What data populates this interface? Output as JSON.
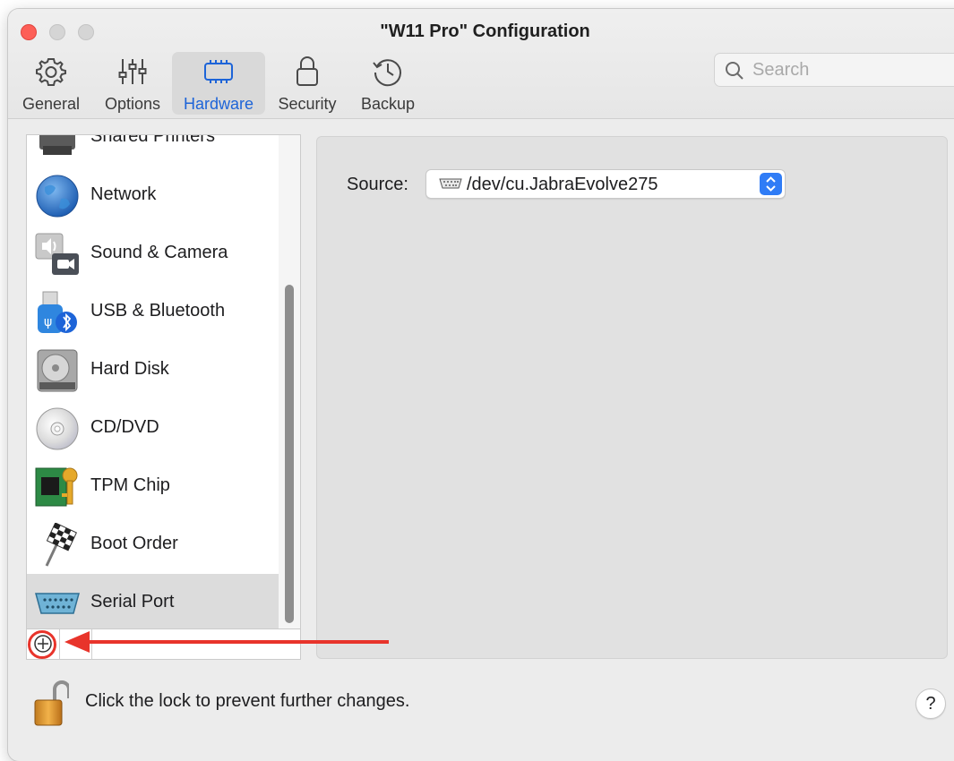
{
  "window": {
    "title": "\"W11 Pro\" Configuration"
  },
  "toolbar": {
    "items": [
      {
        "label": "General",
        "icon": "gear-icon"
      },
      {
        "label": "Options",
        "icon": "sliders-icon"
      },
      {
        "label": "Hardware",
        "icon": "chip-icon",
        "active": true
      },
      {
        "label": "Security",
        "icon": "lock-icon"
      },
      {
        "label": "Backup",
        "icon": "history-clock-icon"
      }
    ],
    "search_placeholder": "Search"
  },
  "sidebar": {
    "items": [
      {
        "label": "Shared Printers",
        "icon": "printer-icon"
      },
      {
        "label": "Network",
        "icon": "globe-icon"
      },
      {
        "label": "Sound & Camera",
        "icon": "speaker-camera-icon"
      },
      {
        "label": "USB & Bluetooth",
        "icon": "usb-bluetooth-icon"
      },
      {
        "label": "Hard Disk",
        "icon": "hard-disk-icon"
      },
      {
        "label": "CD/DVD",
        "icon": "disc-icon"
      },
      {
        "label": "TPM Chip",
        "icon": "tpm-chip-key-icon"
      },
      {
        "label": "Boot Order",
        "icon": "checkered-flag-icon"
      },
      {
        "label": "Serial Port",
        "icon": "serial-port-icon",
        "selected": true
      }
    ],
    "add_label": "+"
  },
  "detail": {
    "source_label": "Source:",
    "source_value": "/dev/cu.JabraEvolve275"
  },
  "footer": {
    "lock_text": "Click the lock to prevent further changes.",
    "help_label": "?"
  },
  "colors": {
    "accent": "#1d64d8",
    "annotation": "#e8342b",
    "close_button": "#fd5f57"
  }
}
